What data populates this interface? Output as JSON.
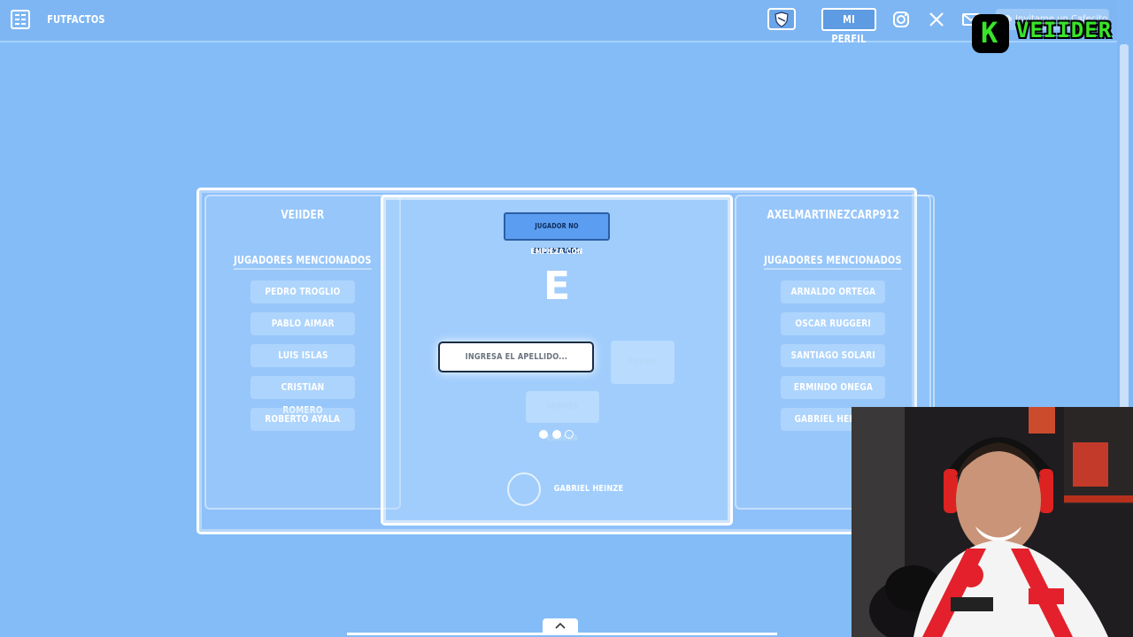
{
  "header": {
    "brand": "FUTFACTOS",
    "profile_label": "MI PERFIL",
    "cafecito_label": "Invitame un Cafecito"
  },
  "watermark": {
    "letter": "K",
    "text": "VEIIDER"
  },
  "left_panel": {
    "player": "VEIIDER",
    "section": "JUGADORES MENCIONADOS",
    "items": [
      "PEDRO TROGLIO",
      "PABLO AIMAR",
      "LUIS ISLAS",
      "CRISTIAN ROMERO",
      "ROBERTO AYALA"
    ]
  },
  "right_panel": {
    "player": "AXELMARTINEZCARP912",
    "section": "JUGADORES MENCIONADOS",
    "items": [
      "ARNALDO ORTEGA",
      "OSCAR RUGGERI",
      "SANTIAGO SOLARI",
      "ERMINDO ONEGA",
      "GABRIEL HEINZE"
    ]
  },
  "center_panel": {
    "alert": "JUGADOR NO ENCONTRADO",
    "starts_with_label": "EMPIEZA CON",
    "letter": "E",
    "input_placeholder": "INGRESA EL APELLIDO...",
    "send_label": "ENVIAR",
    "break_label": "ROMPER CADENA",
    "turn_player": "GABRIEL HEINZE",
    "chain_progress": {
      "filled": 2,
      "total": 3
    }
  },
  "icons": [
    "logo-icon",
    "shield-icon",
    "instagram-icon",
    "x-icon",
    "mail-icon",
    "coffee-icon",
    "chevron-up-icon"
  ],
  "colors": {
    "background": "#84bcf7",
    "alert": "#5b9df0",
    "watermark": "#39e52a"
  }
}
